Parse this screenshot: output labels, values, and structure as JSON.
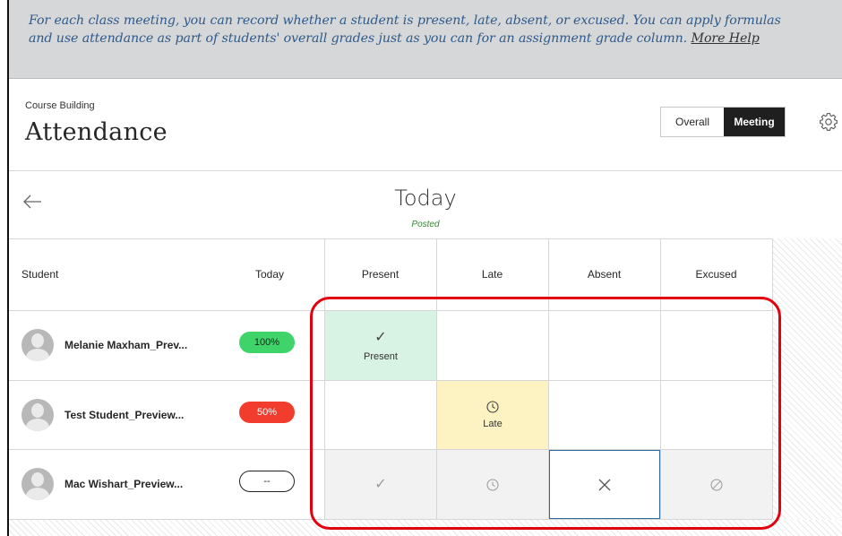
{
  "banner": {
    "line1": "For each class meeting, you can record whether a student is present, late, absent, or excused. You can apply formulas",
    "line2": "and use attendance as part of students' overall grades just as you can for an assignment grade column.",
    "more_help": "More Help"
  },
  "header": {
    "breadcrumb": "Course Building",
    "title": "Attendance",
    "view_toggle": {
      "overall": "Overall",
      "meeting": "Meeting",
      "selected": "Meeting"
    },
    "settings_icon": "gear-icon"
  },
  "date_bar": {
    "back_icon": "arrow-left-icon",
    "title": "Today",
    "status": "Posted"
  },
  "columns": {
    "student": "Student",
    "today": "Today",
    "present": "Present",
    "late": "Late",
    "absent": "Absent",
    "excused": "Excused"
  },
  "students": [
    {
      "name": "Melanie Maxham_Prev...",
      "today": "100%",
      "status": "present"
    },
    {
      "name": "Test Student_Preview...",
      "today": "50%",
      "status": "late"
    },
    {
      "name": "Mac Wishart_Preview...",
      "today": "--",
      "status": "none"
    }
  ],
  "marks": {
    "present": "Present",
    "late": "Late"
  },
  "colors": {
    "present_bg": "#d8f2e3",
    "late_bg": "#fdf3c2",
    "pill_green": "#3fd46a",
    "pill_red": "#f23d2e",
    "highlight": "#e3000f",
    "selected_border": "#2a6aa1",
    "banner_text": "#2f5a8a"
  }
}
